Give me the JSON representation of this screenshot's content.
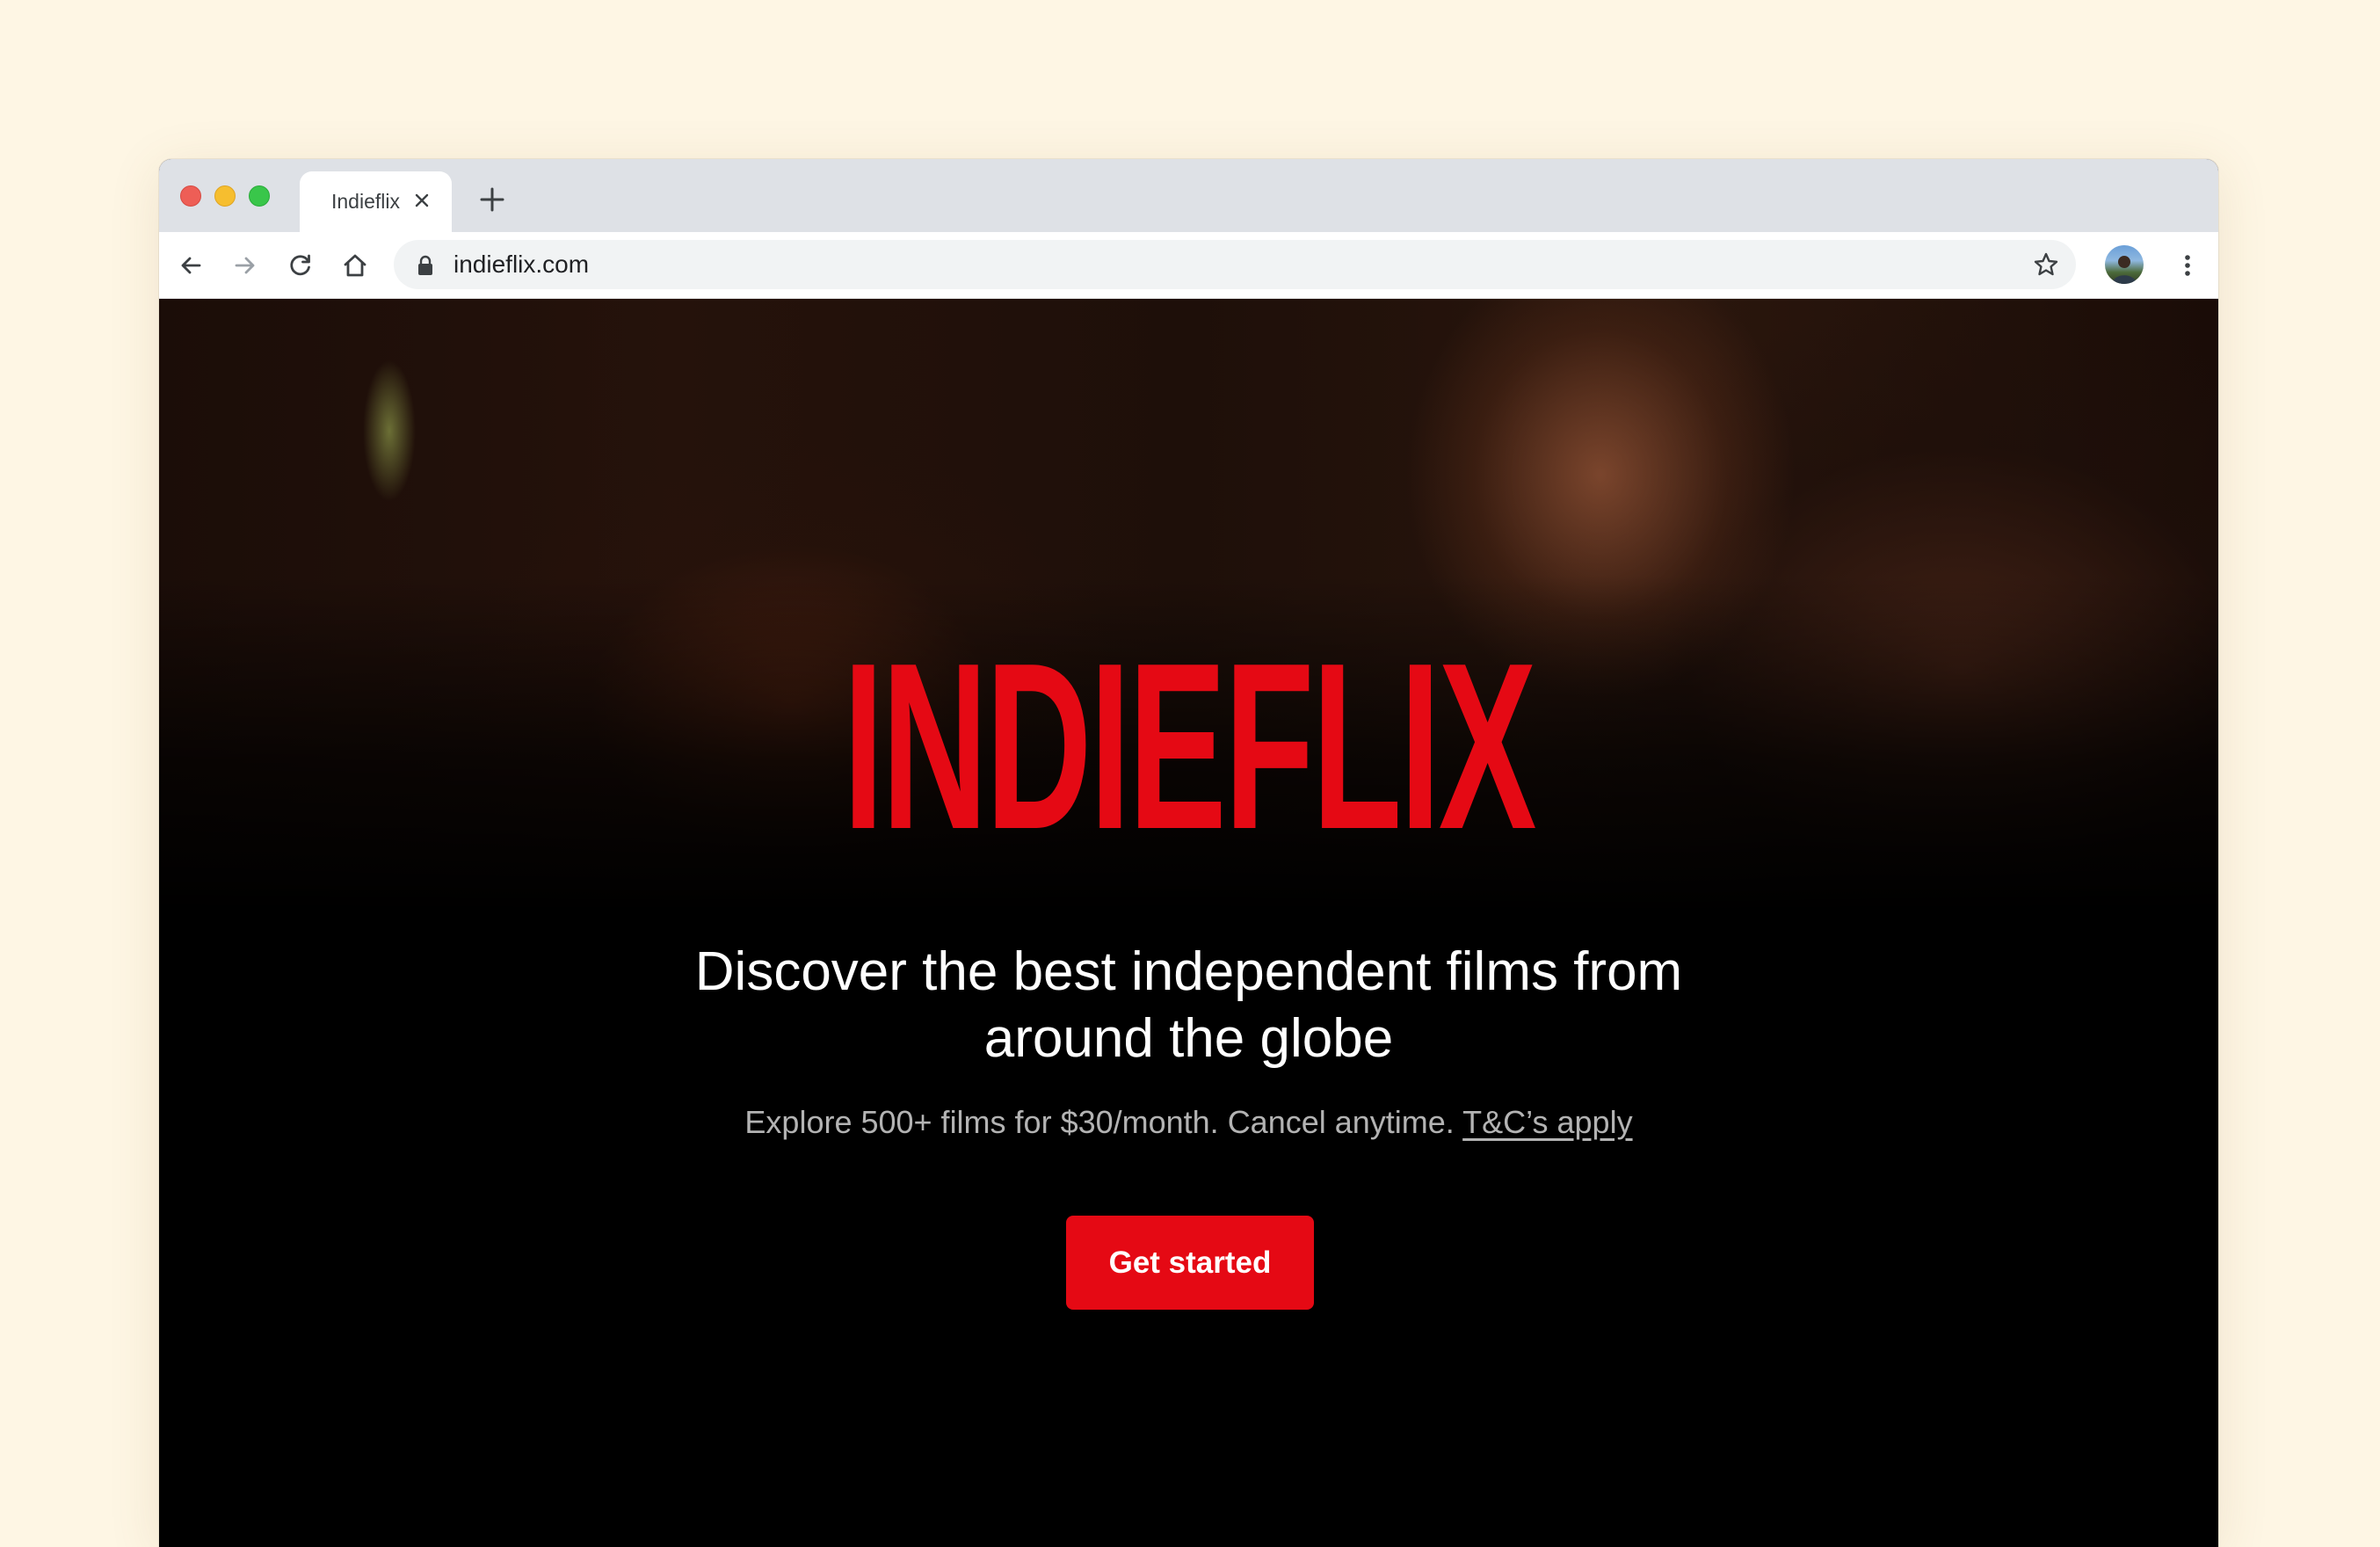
{
  "window": {
    "controls": [
      "close",
      "minimize",
      "maximize"
    ]
  },
  "tab": {
    "title": "Indieflix"
  },
  "toolbar": {
    "url": "indieflix.com",
    "icons": [
      "back-icon",
      "forward-icon",
      "reload-icon",
      "home-icon",
      "lock-icon",
      "star-icon",
      "avatar",
      "menu-dots-icon"
    ]
  },
  "hero": {
    "logo": "INDIEFLIX",
    "headline_line1": "Discover the best independent films from",
    "headline_line2": "around the globe",
    "sub_text": "Explore 500+ films for $30/month. Cancel anytime. ",
    "terms_link": "T&C’s apply",
    "cta_label": "Get started"
  },
  "colors": {
    "brand_red": "#e50914",
    "page_background": "#fef6e4",
    "tab_strip": "#dee1e6"
  }
}
